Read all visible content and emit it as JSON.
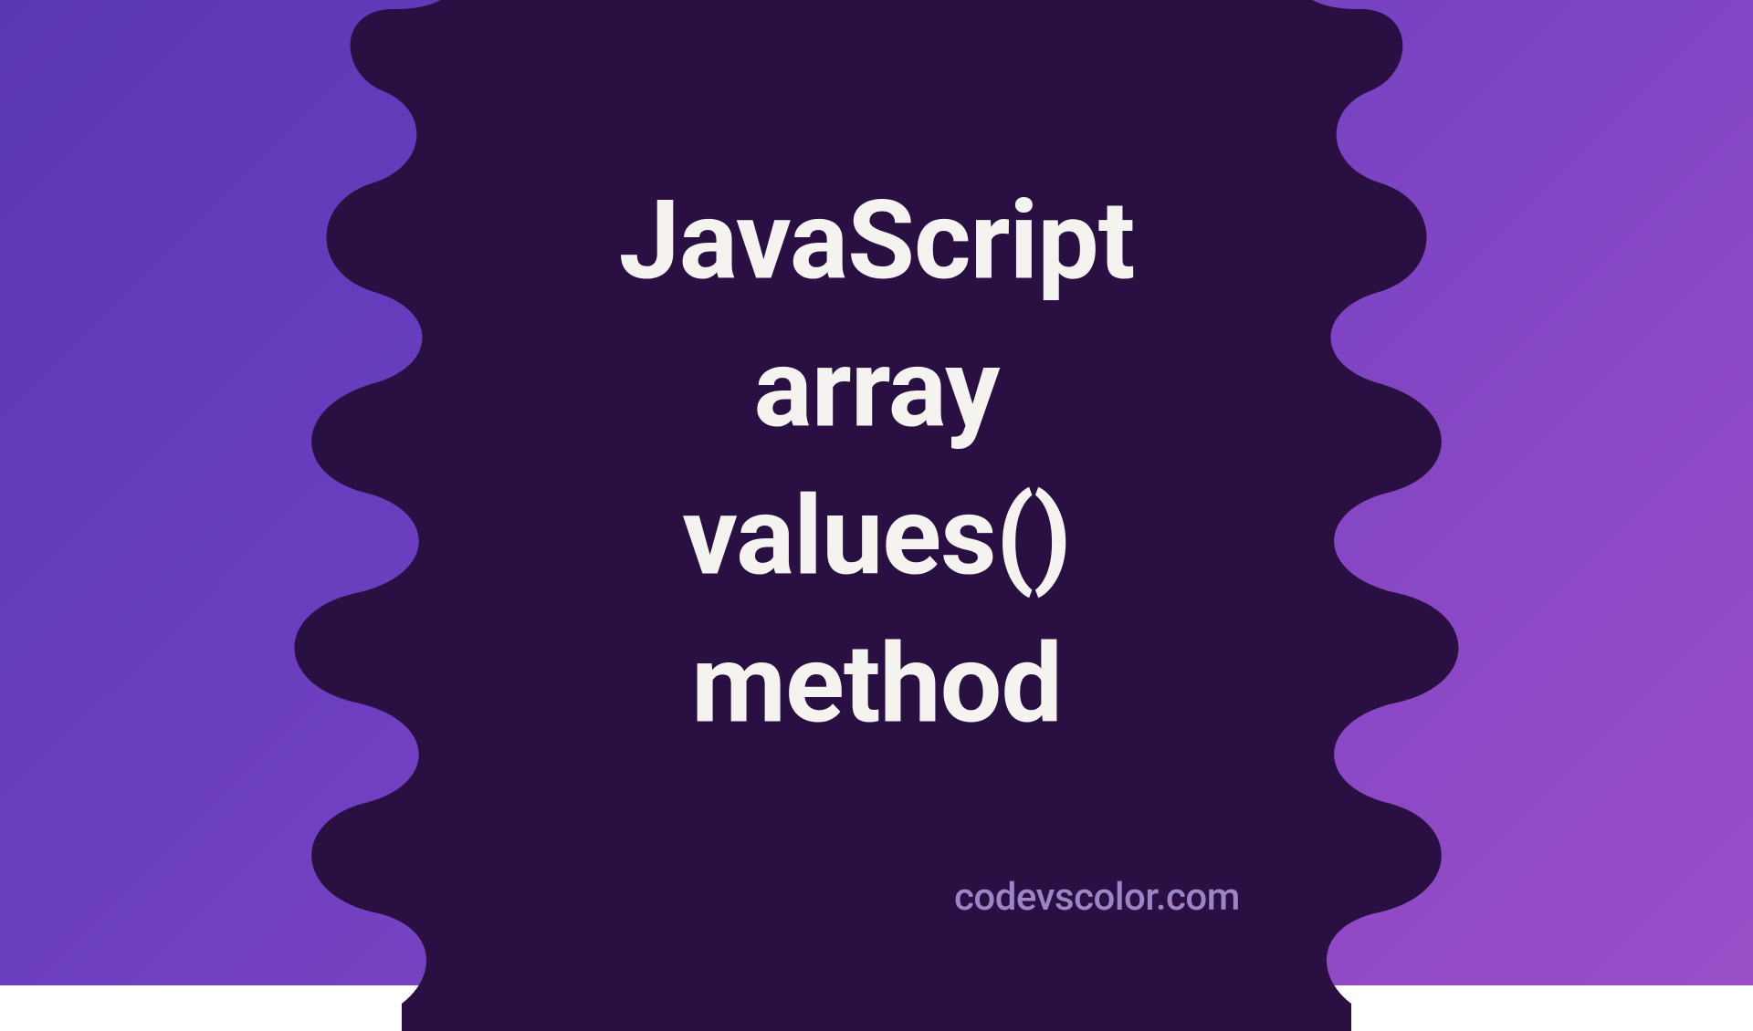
{
  "title": {
    "line1": "JavaScript",
    "line2": "array",
    "line3": "values()",
    "line4": "method"
  },
  "watermark": "codevscolor.com",
  "colors": {
    "blob": "#2a1042",
    "text": "#f5f3f0",
    "watermark": "#9b85c7",
    "bg_start": "#5a38b5",
    "bg_end": "#9b4ec8"
  }
}
